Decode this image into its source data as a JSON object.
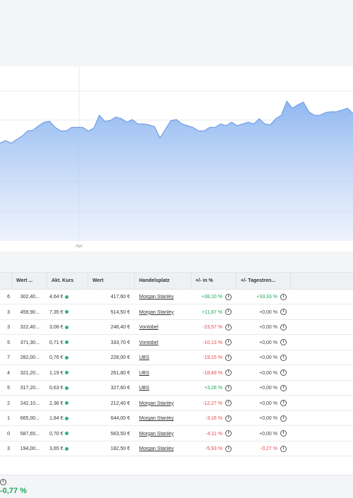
{
  "chart_data": {
    "type": "area",
    "x_tick_labels": [
      "Apr"
    ],
    "color": "#8ab4f0",
    "values": [
      56,
      57.5,
      56,
      58,
      60,
      63,
      63.5,
      66,
      68,
      68.5,
      65,
      63,
      63,
      65,
      65,
      65,
      63,
      64.5,
      72,
      68.5,
      69,
      71,
      70,
      68,
      69.5,
      67,
      67,
      66.5,
      65.5,
      59,
      64,
      69,
      69.5,
      67,
      66,
      65,
      63,
      63,
      65,
      65,
      67,
      66,
      68,
      66,
      67,
      68,
      67,
      70,
      67,
      66.5,
      70,
      72,
      80,
      76,
      78,
      79.5,
      74,
      72,
      72,
      73.5,
      74,
      74,
      75,
      76,
      73
    ]
  },
  "table": {
    "headers": [
      "Wert ...",
      "Akt. Kurs",
      "Wert",
      "Handelsplatz",
      "+/- in %",
      "+/- Tagestren..."
    ],
    "rows": [
      {
        "lead": "6",
        "wert_kauf": "302,40...",
        "kurs": "4,64 €",
        "wert": "417,60 €",
        "platz": "Morgan Stanley",
        "pct": "+38,10 %",
        "pct_sign": "pos",
        "tag": "+33,33 %",
        "tag_sign": "pos"
      },
      {
        "lead": "3",
        "wert_kauf": "459,90...",
        "kurs": "7,35 €",
        "wert": "514,50 €",
        "platz": "Morgan Stanley",
        "pct": "+11,87 %",
        "pct_sign": "pos",
        "tag": "+0,00 %",
        "tag_sign": "neu"
      },
      {
        "lead": "3",
        "wert_kauf": "322,40...",
        "kurs": "3,08 €",
        "wert": "246,40 €",
        "platz": "Vontobel",
        "pct": "-23,57 %",
        "pct_sign": "neg",
        "tag": "+0,00 %",
        "tag_sign": "neu"
      },
      {
        "lead": "5",
        "wert_kauf": "371,30...",
        "kurs": "0,71 €",
        "wert": "333,70 €",
        "platz": "Vontobel",
        "pct": "-10,13 %",
        "pct_sign": "neg",
        "tag": "+0,00 %",
        "tag_sign": "neu"
      },
      {
        "lead": "7",
        "wert_kauf": "282,00...",
        "kurs": "0,76 €",
        "wert": "228,00 €",
        "platz": "UBS",
        "pct": "-19,15 %",
        "pct_sign": "neg",
        "tag": "+0,00 %",
        "tag_sign": "neu"
      },
      {
        "lead": "4",
        "wert_kauf": "321,20...",
        "kurs": "1,19 €",
        "wert": "261,80 €",
        "platz": "UBS",
        "pct": "-18,49 %",
        "pct_sign": "neg",
        "tag": "+0,00 %",
        "tag_sign": "neu"
      },
      {
        "lead": "5",
        "wert_kauf": "317,20...",
        "kurs": "0,63 €",
        "wert": "327,60 €",
        "platz": "UBS",
        "pct": "+3,28 %",
        "pct_sign": "pos",
        "tag": "+0,00 %",
        "tag_sign": "neu"
      },
      {
        "lead": "2",
        "wert_kauf": "242,10...",
        "kurs": "2,36 €",
        "wert": "212,40 €",
        "platz": "Morgan Stanley",
        "pct": "-12,27 %",
        "pct_sign": "neg",
        "tag": "+0,00 %",
        "tag_sign": "neu"
      },
      {
        "lead": "1",
        "wert_kauf": "665,00...",
        "kurs": "1,84 €",
        "wert": "644,00 €",
        "platz": "Morgan Stanley",
        "pct": "-3,16 %",
        "pct_sign": "neg",
        "tag": "+0,00 %",
        "tag_sign": "neu"
      },
      {
        "lead": "0",
        "wert_kauf": "587,65...",
        "kurs": "0,70 €",
        "wert": "563,50 €",
        "platz": "Morgan Stanley",
        "pct": "-4,11 %",
        "pct_sign": "neg",
        "tag": "+0,00 %",
        "tag_sign": "neu"
      },
      {
        "lead": "3",
        "wert_kauf": "194,00...",
        "kurs": "3,65 €",
        "wert": "182,50 €",
        "platz": "Morgan Stanley",
        "pct": "-5,93 %",
        "pct_sign": "neg",
        "tag": "-0,27 %",
        "tag_sign": "neg"
      }
    ]
  },
  "footer": {
    "info_icon": "info-icon",
    "total_change": "-0,77 %"
  },
  "colors": {
    "positive": "#1fa55a",
    "negative": "#e5484d",
    "chart_fill": "#8ab4f0"
  }
}
